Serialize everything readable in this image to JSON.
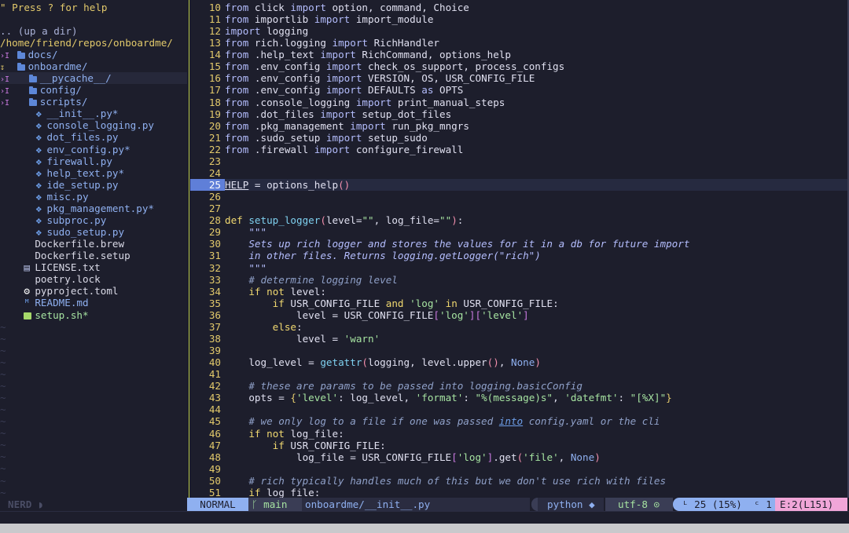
{
  "tree": {
    "help": "\" Press ? for help",
    "updir": ".. (up a dir)",
    "path": "/home/friend/repos/onboardme/",
    "items": [
      {
        "marker": ">",
        "kind": "dir",
        "name": "docs/",
        "depth": 0
      },
      {
        "marker": "v",
        "kind": "dir",
        "name": "onboardme/",
        "depth": 0
      },
      {
        "marker": ">",
        "kind": "dir",
        "name": "__pycache__/",
        "depth": 1
      },
      {
        "marker": ">",
        "kind": "dir",
        "name": "config/",
        "depth": 1
      },
      {
        "marker": ">",
        "kind": "dir",
        "name": "scripts/",
        "depth": 1
      },
      {
        "marker": "",
        "kind": "py",
        "name": "__init__.py*",
        "depth": 1
      },
      {
        "marker": "",
        "kind": "py",
        "name": "console_logging.py",
        "depth": 1
      },
      {
        "marker": "",
        "kind": "py",
        "name": "dot_files.py",
        "depth": 1
      },
      {
        "marker": "",
        "kind": "py",
        "name": "env_config.py*",
        "depth": 1
      },
      {
        "marker": "",
        "kind": "py",
        "name": "firewall.py",
        "depth": 1
      },
      {
        "marker": "",
        "kind": "py",
        "name": "help_text.py*",
        "depth": 1
      },
      {
        "marker": "",
        "kind": "py",
        "name": "ide_setup.py",
        "depth": 1
      },
      {
        "marker": "",
        "kind": "py",
        "name": "misc.py",
        "depth": 1
      },
      {
        "marker": "",
        "kind": "py",
        "name": "pkg_management.py*",
        "depth": 1
      },
      {
        "marker": "",
        "kind": "py",
        "name": "subproc.py",
        "depth": 1
      },
      {
        "marker": "",
        "kind": "py",
        "name": "sudo_setup.py",
        "depth": 1
      },
      {
        "marker": "",
        "kind": "file",
        "name": "Dockerfile.brew",
        "depth": 0
      },
      {
        "marker": "",
        "kind": "file",
        "name": "Dockerfile.setup",
        "depth": 0
      },
      {
        "marker": "",
        "kind": "license",
        "name": "LICENSE.txt",
        "depth": 0
      },
      {
        "marker": "",
        "kind": "file",
        "name": "poetry.lock",
        "depth": 0
      },
      {
        "marker": "",
        "kind": "toml",
        "name": "pyproject.toml",
        "depth": 0
      },
      {
        "marker": "",
        "kind": "md",
        "name": "README.md",
        "depth": 0
      },
      {
        "marker": "",
        "kind": "sh",
        "name": "setup.sh*",
        "depth": 0
      }
    ]
  },
  "editor": {
    "cursor_line": 25,
    "lines": [
      {
        "n": 10,
        "t": "from click import option, command, Choice"
      },
      {
        "n": 11,
        "t": "from importlib import import_module"
      },
      {
        "n": 12,
        "t": "import logging"
      },
      {
        "n": 13,
        "t": "from rich.logging import RichHandler"
      },
      {
        "n": 14,
        "t": "from .help_text import RichCommand, options_help"
      },
      {
        "n": 15,
        "t": "from .env_config import check_os_support, process_configs"
      },
      {
        "n": 16,
        "t": "from .env_config import VERSION, OS, USR_CONFIG_FILE"
      },
      {
        "n": 17,
        "t": "from .env_config import DEFAULTS as OPTS"
      },
      {
        "n": 18,
        "t": "from .console_logging import print_manual_steps"
      },
      {
        "n": 19,
        "t": "from .dot_files import setup_dot_files"
      },
      {
        "n": 20,
        "t": "from .pkg_management import run_pkg_mngrs"
      },
      {
        "n": 21,
        "t": "from .sudo_setup import setup_sudo"
      },
      {
        "n": 22,
        "t": "from .firewall import configure_firewall"
      },
      {
        "n": 23,
        "t": ""
      },
      {
        "n": 24,
        "t": ""
      },
      {
        "n": 25,
        "t": "HELP = options_help()"
      },
      {
        "n": 26,
        "t": ""
      },
      {
        "n": 27,
        "t": ""
      },
      {
        "n": 28,
        "t": "def setup_logger(level=\"\", log_file=\"\"):"
      },
      {
        "n": 29,
        "t": "    \"\"\""
      },
      {
        "n": 30,
        "t": "    Sets up rich logger and stores the values for it in a db for future import"
      },
      {
        "n": 31,
        "t": "    in other files. Returns logging.getLogger(\"rich\")"
      },
      {
        "n": 32,
        "t": "    \"\"\""
      },
      {
        "n": 33,
        "t": "    # determine logging level"
      },
      {
        "n": 34,
        "t": "    if not level:"
      },
      {
        "n": 35,
        "t": "        if USR_CONFIG_FILE and 'log' in USR_CONFIG_FILE:"
      },
      {
        "n": 36,
        "t": "            level = USR_CONFIG_FILE['log']['level']"
      },
      {
        "n": 37,
        "t": "        else:"
      },
      {
        "n": 38,
        "t": "            level = 'warn'"
      },
      {
        "n": 39,
        "t": ""
      },
      {
        "n": 40,
        "t": "    log_level = getattr(logging, level.upper(), None)"
      },
      {
        "n": 41,
        "t": ""
      },
      {
        "n": 42,
        "t": "    # these are params to be passed into logging.basicConfig"
      },
      {
        "n": 43,
        "t": "    opts = {'level': log_level, 'format': \"%(message)s\", 'datefmt': \"[%X]\"}"
      },
      {
        "n": 44,
        "t": ""
      },
      {
        "n": 45,
        "t": "    # we only log to a file if one was passed into config.yaml or the cli"
      },
      {
        "n": 46,
        "t": "    if not log_file:"
      },
      {
        "n": 47,
        "t": "        if USR_CONFIG_FILE:"
      },
      {
        "n": 48,
        "t": "            log_file = USR_CONFIG_FILE['log'].get('file', None)"
      },
      {
        "n": 49,
        "t": ""
      },
      {
        "n": 50,
        "t": "    # rich typically handles much of this but we don't use rich with files"
      },
      {
        "n": 51,
        "t": "    if log_file:"
      }
    ]
  },
  "statusline": {
    "nerd_label": "NERD",
    "mode": "NORMAL",
    "branch": "main",
    "file": "onboardme/__init__.py",
    "language": "python",
    "encoding": "utf-8",
    "position": "25 (15%)",
    "column": "1",
    "errors": "E:2(L151)"
  },
  "colors": {
    "background": "#1d1e2c",
    "separator": "#b9c94a",
    "line_number": "#e2c96b",
    "mode_bg": "#8fb0f0",
    "error_bg": "#f0a6d8"
  }
}
